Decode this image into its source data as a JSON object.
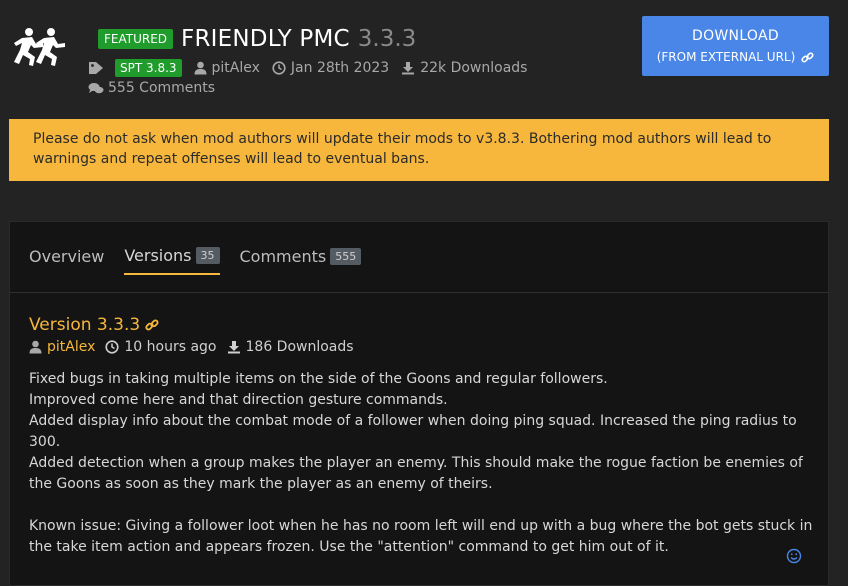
{
  "header": {
    "featured_badge": "FEATURED",
    "mod_name": "FRIENDLY PMC",
    "mod_version": "3.3.3",
    "spt_badge": "SPT 3.8.3",
    "author": "pitAlex",
    "date": "Jan 28th 2023",
    "downloads": "22k Downloads",
    "comments": "555 Comments",
    "icons": [
      "runners-logo-icon",
      "tag-icon",
      "user-icon",
      "clock-icon",
      "download-icon",
      "comments-icon"
    ]
  },
  "download_button": {
    "line1": "DOWNLOAD",
    "line2": "(FROM EXTERNAL URL)",
    "icon": "link-icon",
    "color": "#4a86e8"
  },
  "warning": {
    "text": "Please do not ask when mod authors will update their mods to v3.8.3. Bothering mod authors will lead to warnings and repeat offenses will lead to eventual bans.",
    "color": "#f6b73c"
  },
  "tabs": [
    {
      "label": "Overview",
      "count": ""
    },
    {
      "label": "Versions",
      "count": "35",
      "active": true
    },
    {
      "label": "Comments",
      "count": "555"
    }
  ],
  "version_entry": {
    "title": "Version 3.3.3",
    "author": "pitAlex",
    "time": "10 hours ago",
    "downloads": "186 Downloads",
    "notes": [
      "Fixed bugs in taking multiple items on the side of the Goons and regular followers.",
      "Improved come here and that direction gesture commands.",
      "Added display info about the combat mode of a follower when doing ping squad. Increased the ping radius to 300.",
      "Added detection when a group makes the player an enemy. This should make the rogue faction be enemies of the Goons as soon as they mark the player as an enemy of theirs."
    ],
    "known_issue": "Known issue: Giving a follower loot when he has no room left will end up with a bug where the bot gets stuck in the take item action and appears frozen. Use the \"attention\" command to get him out of it."
  },
  "colors": {
    "background": "#232323",
    "panel": "#141414",
    "accent": "#f6b73c",
    "featured_green": "#1f9c2b"
  }
}
